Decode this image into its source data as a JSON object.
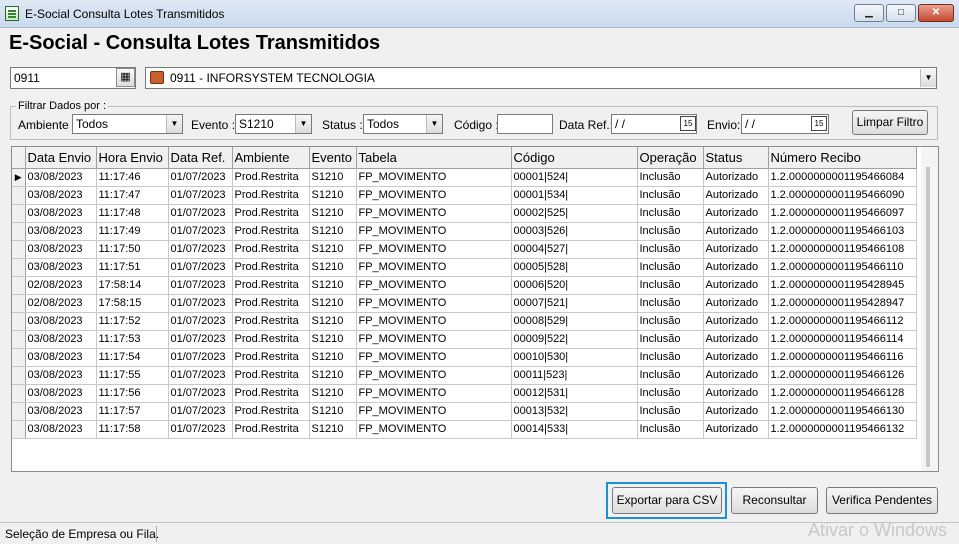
{
  "window": {
    "title": "E-Social Consulta Lotes Transmitidos",
    "min_glyph": "▁",
    "max_glyph": "□",
    "close_glyph": "✕"
  },
  "page_title": "E-Social - Consulta Lotes Transmitidos",
  "company": {
    "code": "0911",
    "name": "0911 - INFORSYSTEM TECNOLOGIA",
    "lookup_icon": "search-grid-icon"
  },
  "filters": {
    "group_label": "Filtrar Dados por :",
    "ambiente_label": "Ambiente :",
    "ambiente_value": "Todos",
    "evento_label": "Evento :",
    "evento_value": "S1210",
    "status_label": "Status :",
    "status_value": "Todos",
    "codigo_label": "Código :",
    "codigo_value": "",
    "data_ref_label": "Data Ref.:",
    "data_ref_value": "/ /",
    "envio_label": "Envio:",
    "envio_value": "/ /",
    "calendar_glyph": "15",
    "clear_button": "Limpar Filtro"
  },
  "grid": {
    "columns": [
      "Data Envio",
      "Hora Envio",
      "Data Ref.",
      "Ambiente",
      "Evento",
      "Tabela",
      "Código",
      "Operação",
      "Status",
      "Número Recibo"
    ],
    "current_row_marker": "▶",
    "rows": [
      [
        "03/08/2023",
        "11:17:46",
        "01/07/2023",
        "Prod.Restrita",
        "S1210",
        "FP_MOVIMENTO",
        "00001|524|",
        "Inclusão",
        "Autorizado",
        "1.2.0000000001195466084"
      ],
      [
        "03/08/2023",
        "11:17:47",
        "01/07/2023",
        "Prod.Restrita",
        "S1210",
        "FP_MOVIMENTO",
        "00001|534|",
        "Inclusão",
        "Autorizado",
        "1.2.0000000001195466090"
      ],
      [
        "03/08/2023",
        "11:17:48",
        "01/07/2023",
        "Prod.Restrita",
        "S1210",
        "FP_MOVIMENTO",
        "00002|525|",
        "Inclusão",
        "Autorizado",
        "1.2.0000000001195466097"
      ],
      [
        "03/08/2023",
        "11:17:49",
        "01/07/2023",
        "Prod.Restrita",
        "S1210",
        "FP_MOVIMENTO",
        "00003|526|",
        "Inclusão",
        "Autorizado",
        "1.2.0000000001195466103"
      ],
      [
        "03/08/2023",
        "11:17:50",
        "01/07/2023",
        "Prod.Restrita",
        "S1210",
        "FP_MOVIMENTO",
        "00004|527|",
        "Inclusão",
        "Autorizado",
        "1.2.0000000001195466108"
      ],
      [
        "03/08/2023",
        "11:17:51",
        "01/07/2023",
        "Prod.Restrita",
        "S1210",
        "FP_MOVIMENTO",
        "00005|528|",
        "Inclusão",
        "Autorizado",
        "1.2.0000000001195466110"
      ],
      [
        "02/08/2023",
        "17:58:14",
        "01/07/2023",
        "Prod.Restrita",
        "S1210",
        "FP_MOVIMENTO",
        "00006|520|",
        "Inclusão",
        "Autorizado",
        "1.2.0000000001195428945"
      ],
      [
        "02/08/2023",
        "17:58:15",
        "01/07/2023",
        "Prod.Restrita",
        "S1210",
        "FP_MOVIMENTO",
        "00007|521|",
        "Inclusão",
        "Autorizado",
        "1.2.0000000001195428947"
      ],
      [
        "03/08/2023",
        "11:17:52",
        "01/07/2023",
        "Prod.Restrita",
        "S1210",
        "FP_MOVIMENTO",
        "00008|529|",
        "Inclusão",
        "Autorizado",
        "1.2.0000000001195466112"
      ],
      [
        "03/08/2023",
        "11:17:53",
        "01/07/2023",
        "Prod.Restrita",
        "S1210",
        "FP_MOVIMENTO",
        "00009|522|",
        "Inclusão",
        "Autorizado",
        "1.2.0000000001195466114"
      ],
      [
        "03/08/2023",
        "11:17:54",
        "01/07/2023",
        "Prod.Restrita",
        "S1210",
        "FP_MOVIMENTO",
        "00010|530|",
        "Inclusão",
        "Autorizado",
        "1.2.0000000001195466116"
      ],
      [
        "03/08/2023",
        "11:17:55",
        "01/07/2023",
        "Prod.Restrita",
        "S1210",
        "FP_MOVIMENTO",
        "00011|523|",
        "Inclusão",
        "Autorizado",
        "1.2.0000000001195466126"
      ],
      [
        "03/08/2023",
        "11:17:56",
        "01/07/2023",
        "Prod.Restrita",
        "S1210",
        "FP_MOVIMENTO",
        "00012|531|",
        "Inclusão",
        "Autorizado",
        "1.2.0000000001195466128"
      ],
      [
        "03/08/2023",
        "11:17:57",
        "01/07/2023",
        "Prod.Restrita",
        "S1210",
        "FP_MOVIMENTO",
        "00013|532|",
        "Inclusão",
        "Autorizado",
        "1.2.0000000001195466130"
      ],
      [
        "03/08/2023",
        "11:17:58",
        "01/07/2023",
        "Prod.Restrita",
        "S1210",
        "FP_MOVIMENTO",
        "00014|533|",
        "Inclusão",
        "Autorizado",
        "1.2.0000000001195466132"
      ]
    ]
  },
  "actions": {
    "export_label": "Exportar para CSV",
    "reconsultar_label": "Reconsultar",
    "verifica_label": "Verifica Pendentes"
  },
  "status_bar": {
    "text": "Seleção de Empresa ou Fila."
  },
  "watermark": "Ativar o Windows",
  "colors": {
    "focus_ring": "#1e90d6",
    "close_button": "#c74a32"
  }
}
